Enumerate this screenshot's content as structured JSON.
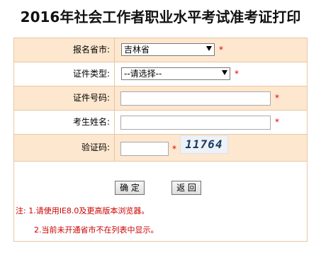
{
  "page": {
    "title": "2016年社会工作者职业水平考试准考证打印"
  },
  "form": {
    "province": {
      "label": "报名省市:",
      "value": "吉林省",
      "required": "*"
    },
    "id_type": {
      "label": "证件类型:",
      "value": "--请选择--",
      "required": "*"
    },
    "id_number": {
      "label": "证件号码:",
      "value": "",
      "required": "*"
    },
    "name": {
      "label": "考生姓名:",
      "value": "",
      "required": "*"
    },
    "captcha": {
      "label": "验证码:",
      "value": "",
      "required": "*",
      "image_text": "11764"
    }
  },
  "buttons": {
    "confirm": "确 定",
    "back": "返 回"
  },
  "notes": {
    "line1": "注: 1.请使用IE8.0及更高版本浏览器。",
    "line2": "2.当前未开通省市不在列表中显示。"
  },
  "colors": {
    "row_orange": "#fde7cf",
    "border": "#e8c6a4",
    "required_red": "#e00000",
    "note_red": "#cc0000"
  }
}
